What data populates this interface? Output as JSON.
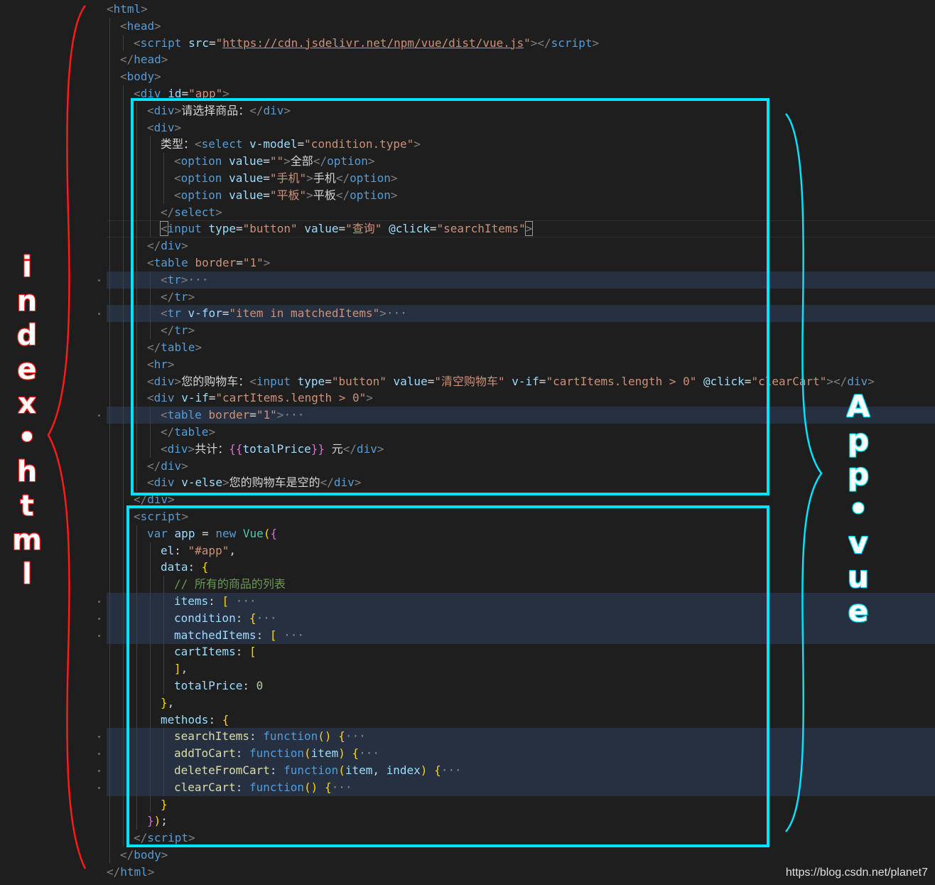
{
  "lines": [
    {
      "indent": 0,
      "tokens": [
        [
          "br",
          "<"
        ],
        [
          "tag",
          "html"
        ],
        [
          "br",
          ">"
        ]
      ]
    },
    {
      "indent": 1,
      "tokens": [
        [
          "br",
          "<"
        ],
        [
          "tag",
          "head"
        ],
        [
          "br",
          ">"
        ]
      ]
    },
    {
      "indent": 2,
      "tokens": [
        [
          "br",
          "<"
        ],
        [
          "tag",
          "script"
        ],
        [
          "txt",
          " "
        ],
        [
          "attr",
          "src"
        ],
        [
          "txt",
          "="
        ],
        [
          "str",
          "\""
        ],
        [
          "str url",
          "https://cdn.jsdelivr.net/npm/vue/dist/vue.js"
        ],
        [
          "str",
          "\""
        ],
        [
          "br",
          "></"
        ],
        [
          "tag",
          "script"
        ],
        [
          "br",
          ">"
        ]
      ]
    },
    {
      "indent": 1,
      "tokens": [
        [
          "br",
          "</"
        ],
        [
          "tag",
          "head"
        ],
        [
          "br",
          ">"
        ]
      ]
    },
    {
      "indent": 1,
      "tokens": [
        [
          "br",
          "<"
        ],
        [
          "tag",
          "body"
        ],
        [
          "br",
          ">"
        ]
      ]
    },
    {
      "indent": 2,
      "tokens": [
        [
          "br",
          "<"
        ],
        [
          "tag",
          "div"
        ],
        [
          "txt",
          " "
        ],
        [
          "attr",
          "id"
        ],
        [
          "txt",
          "="
        ],
        [
          "str",
          "\"app\""
        ],
        [
          "br",
          ">"
        ]
      ]
    },
    {
      "indent": 3,
      "tokens": [
        [
          "br",
          "<"
        ],
        [
          "tag",
          "div"
        ],
        [
          "br",
          ">"
        ],
        [
          "txt",
          "请选择商品："
        ],
        [
          "br",
          "</"
        ],
        [
          "tag",
          "div"
        ],
        [
          "br",
          ">"
        ]
      ]
    },
    {
      "indent": 3,
      "tokens": [
        [
          "br",
          "<"
        ],
        [
          "tag",
          "div"
        ],
        [
          "br",
          ">"
        ]
      ]
    },
    {
      "indent": 4,
      "tokens": [
        [
          "txt",
          "类型："
        ],
        [
          "br",
          "<"
        ],
        [
          "tag",
          "select"
        ],
        [
          "txt",
          " "
        ],
        [
          "attr",
          "v-model"
        ],
        [
          "txt",
          "="
        ],
        [
          "str",
          "\"condition.type\""
        ],
        [
          "br",
          ">"
        ]
      ]
    },
    {
      "indent": 5,
      "tokens": [
        [
          "br",
          "<"
        ],
        [
          "tag",
          "option"
        ],
        [
          "txt",
          " "
        ],
        [
          "attr",
          "value"
        ],
        [
          "txt",
          "="
        ],
        [
          "str",
          "\"\""
        ],
        [
          "br",
          ">"
        ],
        [
          "txt",
          "全部"
        ],
        [
          "br",
          "</"
        ],
        [
          "tag",
          "option"
        ],
        [
          "br",
          ">"
        ]
      ]
    },
    {
      "indent": 5,
      "tokens": [
        [
          "br",
          "<"
        ],
        [
          "tag",
          "option"
        ],
        [
          "txt",
          " "
        ],
        [
          "attr",
          "value"
        ],
        [
          "txt",
          "="
        ],
        [
          "str",
          "\"手机\""
        ],
        [
          "br",
          ">"
        ],
        [
          "txt",
          "手机"
        ],
        [
          "br",
          "</"
        ],
        [
          "tag",
          "option"
        ],
        [
          "br",
          ">"
        ]
      ]
    },
    {
      "indent": 5,
      "tokens": [
        [
          "br",
          "<"
        ],
        [
          "tag",
          "option"
        ],
        [
          "txt",
          " "
        ],
        [
          "attr",
          "value"
        ],
        [
          "txt",
          "="
        ],
        [
          "str",
          "\"平板\""
        ],
        [
          "br",
          ">"
        ],
        [
          "txt",
          "平板"
        ],
        [
          "br",
          "</"
        ],
        [
          "tag",
          "option"
        ],
        [
          "br",
          ">"
        ]
      ]
    },
    {
      "indent": 4,
      "tokens": [
        [
          "br",
          "</"
        ],
        [
          "tag",
          "select"
        ],
        [
          "br",
          ">"
        ]
      ]
    },
    {
      "indent": 4,
      "cursor": true,
      "tokens": [
        [
          "br cbox",
          "<"
        ],
        [
          "tag",
          "input"
        ],
        [
          "txt",
          " "
        ],
        [
          "attr",
          "type"
        ],
        [
          "txt",
          "="
        ],
        [
          "str",
          "\"button\""
        ],
        [
          "txt",
          " "
        ],
        [
          "attr",
          "value"
        ],
        [
          "txt",
          "="
        ],
        [
          "str",
          "\"查询\""
        ],
        [
          "txt",
          " "
        ],
        [
          "attr",
          "@click"
        ],
        [
          "txt",
          "="
        ],
        [
          "str",
          "\"searchItems\""
        ],
        [
          "br cbox",
          ">"
        ]
      ]
    },
    {
      "indent": 3,
      "tokens": [
        [
          "br",
          "</"
        ],
        [
          "tag",
          "div"
        ],
        [
          "br",
          ">"
        ]
      ]
    },
    {
      "indent": 3,
      "tokens": [
        [
          "br",
          "<"
        ],
        [
          "tag",
          "table"
        ],
        [
          "txt",
          " "
        ],
        [
          "warn",
          "border"
        ],
        [
          "txt",
          "="
        ],
        [
          "str",
          "\"1\""
        ],
        [
          "br",
          ">"
        ]
      ]
    },
    {
      "indent": 4,
      "folded": true,
      "tokens": [
        [
          "br",
          "<"
        ],
        [
          "tag",
          "tr"
        ],
        [
          "br",
          ">"
        ],
        [
          "dots",
          "···"
        ]
      ]
    },
    {
      "indent": 4,
      "tokens": [
        [
          "br",
          "</"
        ],
        [
          "tag",
          "tr"
        ],
        [
          "br",
          ">"
        ]
      ]
    },
    {
      "indent": 4,
      "folded": true,
      "tokens": [
        [
          "br",
          "<"
        ],
        [
          "tag",
          "tr"
        ],
        [
          "txt",
          " "
        ],
        [
          "attr",
          "v-for"
        ],
        [
          "txt",
          "="
        ],
        [
          "str",
          "\"item in matchedItems\""
        ],
        [
          "br",
          ">"
        ],
        [
          "dots",
          "···"
        ]
      ]
    },
    {
      "indent": 4,
      "tokens": [
        [
          "br",
          "</"
        ],
        [
          "tag",
          "tr"
        ],
        [
          "br",
          ">"
        ]
      ]
    },
    {
      "indent": 3,
      "tokens": [
        [
          "br",
          "</"
        ],
        [
          "tag",
          "table"
        ],
        [
          "br",
          ">"
        ]
      ]
    },
    {
      "indent": 3,
      "tokens": [
        [
          "br",
          "<"
        ],
        [
          "tag",
          "hr"
        ],
        [
          "br",
          ">"
        ]
      ]
    },
    {
      "indent": 3,
      "tokens": [
        [
          "br",
          "<"
        ],
        [
          "tag",
          "div"
        ],
        [
          "br",
          ">"
        ],
        [
          "txt",
          "您的购物车："
        ],
        [
          "br",
          "<"
        ],
        [
          "tag",
          "input"
        ],
        [
          "txt",
          " "
        ],
        [
          "attr",
          "type"
        ],
        [
          "txt",
          "="
        ],
        [
          "str",
          "\"button\""
        ],
        [
          "txt",
          " "
        ],
        [
          "attr",
          "value"
        ],
        [
          "txt",
          "="
        ],
        [
          "str",
          "\"清空购物车\""
        ],
        [
          "txt",
          " "
        ],
        [
          "attr",
          "v-if"
        ],
        [
          "txt",
          "="
        ],
        [
          "str",
          "\"cartItems.length > 0\""
        ],
        [
          "txt",
          " "
        ],
        [
          "attr",
          "@click"
        ],
        [
          "txt",
          "="
        ],
        [
          "str",
          "\"clearCart\""
        ],
        [
          "br",
          "></"
        ],
        [
          "tag",
          "div"
        ],
        [
          "br",
          ">"
        ]
      ]
    },
    {
      "indent": 3,
      "tokens": [
        [
          "br",
          "<"
        ],
        [
          "tag",
          "div"
        ],
        [
          "txt",
          " "
        ],
        [
          "attr",
          "v-if"
        ],
        [
          "txt",
          "="
        ],
        [
          "str",
          "\"cartItems.length > 0\""
        ],
        [
          "br",
          ">"
        ]
      ]
    },
    {
      "indent": 4,
      "folded": true,
      "tokens": [
        [
          "br",
          "<"
        ],
        [
          "tag",
          "table"
        ],
        [
          "txt",
          " "
        ],
        [
          "warn",
          "border"
        ],
        [
          "txt",
          "="
        ],
        [
          "str",
          "\"1\""
        ],
        [
          "br",
          ">"
        ],
        [
          "dots",
          "···"
        ]
      ]
    },
    {
      "indent": 4,
      "tokens": [
        [
          "br",
          "</"
        ],
        [
          "tag",
          "table"
        ],
        [
          "br",
          ">"
        ]
      ]
    },
    {
      "indent": 4,
      "tokens": [
        [
          "br",
          "<"
        ],
        [
          "tag",
          "div"
        ],
        [
          "br",
          ">"
        ],
        [
          "txt",
          "共计："
        ],
        [
          "brk2",
          "{{"
        ],
        [
          "prop",
          "totalPrice"
        ],
        [
          "brk2",
          "}}"
        ],
        [
          "txt",
          " 元"
        ],
        [
          "br",
          "</"
        ],
        [
          "tag",
          "div"
        ],
        [
          "br",
          ">"
        ]
      ]
    },
    {
      "indent": 3,
      "tokens": [
        [
          "br",
          "</"
        ],
        [
          "tag",
          "div"
        ],
        [
          "br",
          ">"
        ]
      ]
    },
    {
      "indent": 3,
      "tokens": [
        [
          "br",
          "<"
        ],
        [
          "tag",
          "div"
        ],
        [
          "txt",
          " "
        ],
        [
          "attr",
          "v-else"
        ],
        [
          "br",
          ">"
        ],
        [
          "txt",
          "您的购物车是空的"
        ],
        [
          "br",
          "</"
        ],
        [
          "tag",
          "div"
        ],
        [
          "br",
          ">"
        ]
      ]
    },
    {
      "indent": 2,
      "tokens": [
        [
          "br",
          "</"
        ],
        [
          "tag",
          "div"
        ],
        [
          "br",
          ">"
        ]
      ]
    },
    {
      "indent": 2,
      "tokens": [
        [
          "br",
          "<"
        ],
        [
          "tag",
          "script"
        ],
        [
          "br",
          ">"
        ]
      ]
    },
    {
      "indent": 3,
      "tokens": [
        [
          "kw",
          "var"
        ],
        [
          "txt",
          " "
        ],
        [
          "prop",
          "app"
        ],
        [
          "txt",
          " = "
        ],
        [
          "kw",
          "new"
        ],
        [
          "txt",
          " "
        ],
        [
          "cls",
          "Vue"
        ],
        [
          "brk",
          "("
        ],
        [
          "brk2",
          "{"
        ]
      ]
    },
    {
      "indent": 4,
      "tokens": [
        [
          "prop",
          "el"
        ],
        [
          "txt",
          ": "
        ],
        [
          "str",
          "\"#app\""
        ],
        [
          "txt",
          ","
        ]
      ]
    },
    {
      "indent": 4,
      "tokens": [
        [
          "prop",
          "data"
        ],
        [
          "txt",
          ": "
        ],
        [
          "brk",
          "{"
        ]
      ]
    },
    {
      "indent": 5,
      "tokens": [
        [
          "cm",
          "// 所有的商品的列表"
        ]
      ]
    },
    {
      "indent": 5,
      "folded": true,
      "tokens": [
        [
          "prop",
          "items"
        ],
        [
          "txt",
          ": "
        ],
        [
          "brk",
          "["
        ],
        [
          "txt",
          " "
        ],
        [
          "dots",
          "···"
        ]
      ]
    },
    {
      "indent": 5,
      "folded": true,
      "tokens": [
        [
          "prop",
          "condition"
        ],
        [
          "txt",
          ": "
        ],
        [
          "brk",
          "{"
        ],
        [
          "dots",
          "···"
        ]
      ]
    },
    {
      "indent": 5,
      "folded": true,
      "tokens": [
        [
          "prop",
          "matchedItems"
        ],
        [
          "txt",
          ": "
        ],
        [
          "brk",
          "["
        ],
        [
          "txt",
          " "
        ],
        [
          "dots",
          "···"
        ]
      ]
    },
    {
      "indent": 5,
      "tokens": [
        [
          "prop",
          "cartItems"
        ],
        [
          "txt",
          ": "
        ],
        [
          "brk",
          "["
        ]
      ]
    },
    {
      "indent": 5,
      "tokens": [
        [
          "brk",
          "]"
        ],
        [
          "txt",
          ","
        ]
      ]
    },
    {
      "indent": 5,
      "tokens": [
        [
          "prop",
          "totalPrice"
        ],
        [
          "txt",
          ": "
        ],
        [
          "num",
          "0"
        ]
      ]
    },
    {
      "indent": 4,
      "tokens": [
        [
          "brk",
          "}"
        ],
        [
          "txt",
          ","
        ]
      ]
    },
    {
      "indent": 4,
      "tokens": [
        [
          "prop",
          "methods"
        ],
        [
          "txt",
          ": "
        ],
        [
          "brk",
          "{"
        ]
      ]
    },
    {
      "indent": 5,
      "folded": true,
      "tokens": [
        [
          "fn",
          "searchItems"
        ],
        [
          "txt",
          ": "
        ],
        [
          "kw",
          "function"
        ],
        [
          "brk",
          "()"
        ],
        [
          "txt",
          " "
        ],
        [
          "brk",
          "{"
        ],
        [
          "dots",
          "···"
        ]
      ]
    },
    {
      "indent": 5,
      "folded": true,
      "tokens": [
        [
          "fn",
          "addToCart"
        ],
        [
          "txt",
          ": "
        ],
        [
          "kw",
          "function"
        ],
        [
          "brk",
          "("
        ],
        [
          "prop",
          "item"
        ],
        [
          "brk",
          ")"
        ],
        [
          "txt",
          " "
        ],
        [
          "brk",
          "{"
        ],
        [
          "dots",
          "···"
        ]
      ]
    },
    {
      "indent": 5,
      "folded": true,
      "tokens": [
        [
          "fn",
          "deleteFromCart"
        ],
        [
          "txt",
          ": "
        ],
        [
          "kw",
          "function"
        ],
        [
          "brk",
          "("
        ],
        [
          "prop",
          "item"
        ],
        [
          "txt",
          ", "
        ],
        [
          "prop",
          "index"
        ],
        [
          "brk",
          ")"
        ],
        [
          "txt",
          " "
        ],
        [
          "brk",
          "{"
        ],
        [
          "dots",
          "···"
        ]
      ]
    },
    {
      "indent": 5,
      "folded": true,
      "tokens": [
        [
          "fn",
          "clearCart"
        ],
        [
          "txt",
          ": "
        ],
        [
          "kw",
          "function"
        ],
        [
          "brk",
          "()"
        ],
        [
          "txt",
          " "
        ],
        [
          "brk",
          "{"
        ],
        [
          "dots",
          "···"
        ]
      ]
    },
    {
      "indent": 4,
      "tokens": [
        [
          "brk",
          "}"
        ]
      ]
    },
    {
      "indent": 3,
      "tokens": [
        [
          "brk2",
          "}"
        ],
        [
          "brk",
          ")"
        ],
        [
          "txt",
          ";"
        ]
      ]
    },
    {
      "indent": 2,
      "tokens": [
        [
          "br",
          "</"
        ],
        [
          "tag",
          "script"
        ],
        [
          "br",
          ">"
        ]
      ]
    },
    {
      "indent": 1,
      "tokens": [
        [
          "br",
          "</"
        ],
        [
          "tag",
          "body"
        ],
        [
          "br",
          ">"
        ]
      ]
    },
    {
      "indent": 0,
      "tokens": [
        [
          "br",
          "</"
        ],
        [
          "tag",
          "html"
        ],
        [
          "br",
          ">"
        ]
      ]
    }
  ],
  "annotations": {
    "index_label": [
      "i",
      "n",
      "d",
      "e",
      "x",
      "•",
      "h",
      "t",
      "m",
      "l"
    ],
    "app_label": [
      "A",
      "p",
      "p",
      "•",
      "v",
      "u",
      "e"
    ],
    "index_color": "#ff1a1a",
    "app_color": "#00e5ff"
  },
  "watermark": "https://blog.csdn.net/planet7"
}
